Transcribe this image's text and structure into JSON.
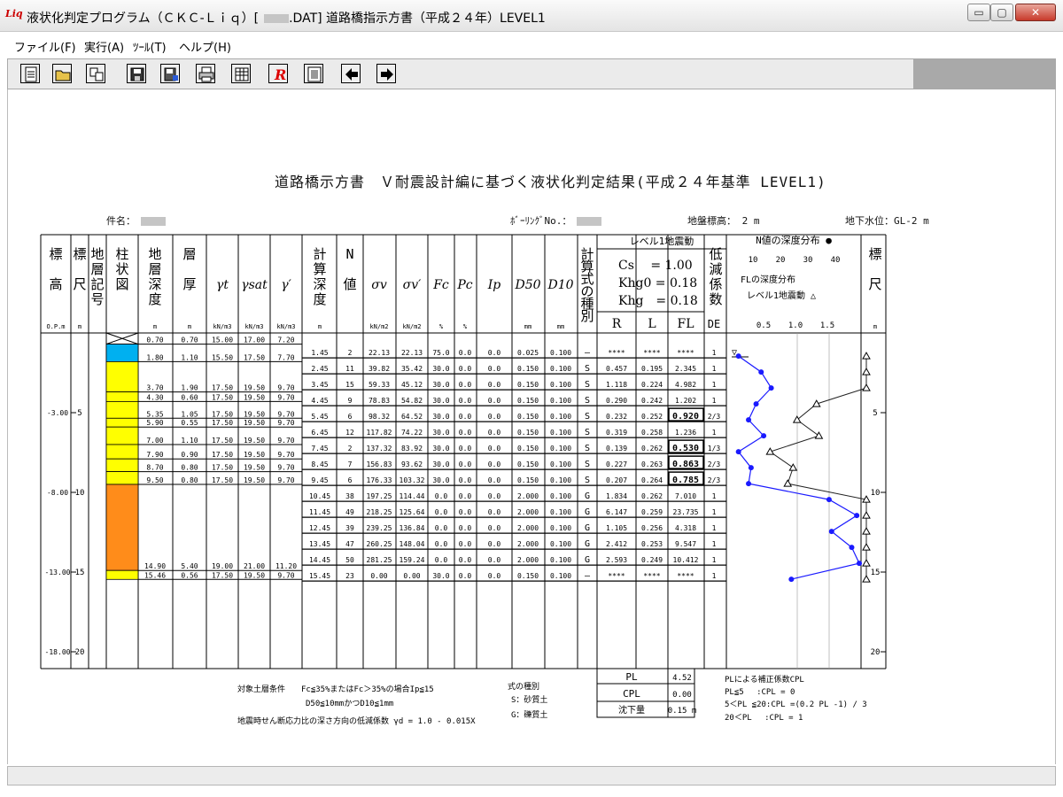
{
  "window": {
    "app_icon_text": "Liq",
    "title": "液状化判定プログラム（ＣＫＣ-Ｌｉｑ）[",
    "title_tail": ".DAT] 道路橋指示方書（平成２４年）LEVEL1",
    "min": "▭",
    "max": "▢",
    "close": "✕"
  },
  "menu": [
    "ファイル(F)",
    "実行(A)",
    "ﾂｰﾙ(T)",
    "ヘルプ(H)"
  ],
  "toolbar_icons": [
    "new-document-icon",
    "open-folder-icon",
    "copy-icon",
    "save-icon",
    "save-as-icon",
    "print-icon",
    "table-icon",
    "r-icon",
    "page-icon",
    "left-arrow-icon",
    "right-arrow-icon"
  ],
  "doc": {
    "title": "道路橋示方書　Ｖ耐震設計編に基づく液状化判定結果(平成２４年基準 LEVEL1)",
    "case_label": "件名：",
    "boring_label": "ﾎﾞｰﾘﾝｸﾞNo.：",
    "ground_elev": "地盤標高： 2 m",
    "water_level": "地下水位：GL-2 m"
  },
  "headers": {
    "elev": "標\n\n高",
    "scale": "標\n\n尺",
    "soil_code": "地\n層\n記\n号",
    "column": "柱\n状\n図",
    "depth": "地\n層\n深\n度",
    "thick": "層\n\n厚",
    "gt": "γt",
    "gsat": "γsat",
    "gp": "γ′",
    "calc_depth": "計\n算\n深\n度",
    "n": "N\n\n値",
    "sv": "σv",
    "svp": "σv′",
    "fc": "Fc",
    "pc": "Pc",
    "ip": "Ip",
    "d50": "D50",
    "d10": "D10",
    "formula": "計\n算\n式\nの\n種\n別",
    "level_group": "レベル1地震動",
    "cs": "Cs　 = 1.00",
    "khg0": "Khg0 = 0.18",
    "khg": "Khg　= 0.18",
    "reduce": "低\n減\n係\n数",
    "r": "R",
    "l": "L",
    "fl": "FL",
    "de": "DE",
    "nplot_title": "N値の深度分布 ●",
    "nplot_ticks": [
      "10",
      "20",
      "30",
      "40"
    ],
    "flplot_title": "FLの深度分布",
    "flplot_sub": "レベル1地震動 △",
    "flplot_ticks": [
      "0.5",
      "1.0",
      "1.5"
    ],
    "scale2": "標\n\n尺"
  },
  "units": {
    "elev": "O.P.m",
    "scale": "m",
    "depth": "m",
    "thick": "m",
    "gt": "kN/m3",
    "gsat": "kN/m3",
    "gp": "kN/m3",
    "calc_depth": "m",
    "sv": "kN/m2",
    "svp": "kN/m2",
    "fc": "%",
    "pc": "%",
    "d50": "mm",
    "d10": "mm",
    "scale2": "m"
  },
  "elev_labels": [
    "-3.00",
    "-8.00",
    "-13.00",
    "-18.00"
  ],
  "scale_labels": [
    "5",
    "10",
    "15",
    "20"
  ],
  "layers": [
    [
      "0.70",
      "0.70",
      "15.00",
      "17.00",
      "7.20"
    ],
    [
      "1.80",
      "1.10",
      "15.50",
      "17.50",
      "7.70"
    ],
    [
      "3.70",
      "1.90",
      "17.50",
      "19.50",
      "9.70"
    ],
    [
      "4.30",
      "0.60",
      "17.50",
      "19.50",
      "9.70"
    ],
    [
      "5.35",
      "1.05",
      "17.50",
      "19.50",
      "9.70"
    ],
    [
      "5.90",
      "0.55",
      "17.50",
      "19.50",
      "9.70"
    ],
    [
      "7.00",
      "1.10",
      "17.50",
      "19.50",
      "9.70"
    ],
    [
      "7.90",
      "0.90",
      "17.50",
      "19.50",
      "9.70"
    ],
    [
      "8.70",
      "0.80",
      "17.50",
      "19.50",
      "9.70"
    ],
    [
      "9.50",
      "0.80",
      "17.50",
      "19.50",
      "9.70"
    ],
    [
      "14.90",
      "5.40",
      "19.00",
      "21.00",
      "11.20"
    ],
    [
      "15.46",
      "0.56",
      "17.50",
      "19.50",
      "9.70"
    ]
  ],
  "rows": [
    [
      "1.45",
      "2",
      "22.13",
      "22.13",
      "75.0",
      "0.0",
      "0.0",
      "0.025",
      "0.100",
      "—",
      "****",
      "****",
      "****",
      "1"
    ],
    [
      "2.45",
      "11",
      "39.82",
      "35.42",
      "30.0",
      "0.0",
      "0.0",
      "0.150",
      "0.100",
      "S",
      "0.457",
      "0.195",
      "2.345",
      "1"
    ],
    [
      "3.45",
      "15",
      "59.33",
      "45.12",
      "30.0",
      "0.0",
      "0.0",
      "0.150",
      "0.100",
      "S",
      "1.118",
      "0.224",
      "4.982",
      "1"
    ],
    [
      "4.45",
      "9",
      "78.83",
      "54.82",
      "30.0",
      "0.0",
      "0.0",
      "0.150",
      "0.100",
      "S",
      "0.290",
      "0.242",
      "1.202",
      "1"
    ],
    [
      "5.45",
      "6",
      "98.32",
      "64.52",
      "30.0",
      "0.0",
      "0.0",
      "0.150",
      "0.100",
      "S",
      "0.232",
      "0.252",
      "0.920",
      "2/3"
    ],
    [
      "6.45",
      "12",
      "117.82",
      "74.22",
      "30.0",
      "0.0",
      "0.0",
      "0.150",
      "0.100",
      "S",
      "0.319",
      "0.258",
      "1.236",
      "1"
    ],
    [
      "7.45",
      "2",
      "137.32",
      "83.92",
      "30.0",
      "0.0",
      "0.0",
      "0.150",
      "0.100",
      "S",
      "0.139",
      "0.262",
      "0.530",
      "1/3"
    ],
    [
      "8.45",
      "7",
      "156.83",
      "93.62",
      "30.0",
      "0.0",
      "0.0",
      "0.150",
      "0.100",
      "S",
      "0.227",
      "0.263",
      "0.863",
      "2/3"
    ],
    [
      "9.45",
      "6",
      "176.33",
      "103.32",
      "30.0",
      "0.0",
      "0.0",
      "0.150",
      "0.100",
      "S",
      "0.207",
      "0.264",
      "0.785",
      "2/3"
    ],
    [
      "10.45",
      "38",
      "197.25",
      "114.44",
      "0.0",
      "0.0",
      "0.0",
      "2.000",
      "0.100",
      "G",
      "1.834",
      "0.262",
      "7.010",
      "1"
    ],
    [
      "11.45",
      "49",
      "218.25",
      "125.64",
      "0.0",
      "0.0",
      "0.0",
      "2.000",
      "0.100",
      "G",
      "6.147",
      "0.259",
      "23.735",
      "1"
    ],
    [
      "12.45",
      "39",
      "239.25",
      "136.84",
      "0.0",
      "0.0",
      "0.0",
      "2.000",
      "0.100",
      "G",
      "1.105",
      "0.256",
      "4.318",
      "1"
    ],
    [
      "13.45",
      "47",
      "260.25",
      "148.04",
      "0.0",
      "0.0",
      "0.0",
      "2.000",
      "0.100",
      "G",
      "2.412",
      "0.253",
      "9.547",
      "1"
    ],
    [
      "14.45",
      "50",
      "281.25",
      "159.24",
      "0.0",
      "0.0",
      "0.0",
      "2.000",
      "0.100",
      "G",
      "2.593",
      "0.249",
      "10.412",
      "1"
    ],
    [
      "15.45",
      "23",
      "0.00",
      "0.00",
      "30.0",
      "0.0",
      "0.0",
      "0.150",
      "0.100",
      "—",
      "****",
      "****",
      "****",
      "1"
    ]
  ],
  "chart_data": [
    {
      "type": "line",
      "title": "N値の深度分布",
      "x_ticks": [
        "10",
        "20",
        "30",
        "40"
      ],
      "xlim": [
        0,
        50
      ],
      "depth_labels": [
        "5",
        "10",
        "15",
        "20"
      ],
      "ylim": [
        0,
        20
      ],
      "series": [
        {
          "name": "N値",
          "points": [
            [
              2,
              1.45
            ],
            [
              11,
              2.45
            ],
            [
              15,
              3.45
            ],
            [
              9,
              4.45
            ],
            [
              6,
              5.45
            ],
            [
              12,
              6.45
            ],
            [
              2,
              7.45
            ],
            [
              7,
              8.45
            ],
            [
              6,
              9.45
            ],
            [
              38,
              10.45
            ],
            [
              49,
              11.45
            ],
            [
              39,
              12.45
            ],
            [
              47,
              13.45
            ],
            [
              50,
              14.45
            ],
            [
              23,
              15.45
            ]
          ]
        }
      ]
    },
    {
      "type": "line",
      "title": "FLの深度分布",
      "subtitle": "レベル1地震動",
      "x_ticks": [
        "0.5",
        "1.0",
        "1.5"
      ],
      "xlim": [
        0,
        2.0
      ],
      "ylim": [
        0,
        20
      ],
      "series": [
        {
          "name": "FL",
          "points": [
            [
              2.0,
              1.45
            ],
            [
              2.0,
              2.45
            ],
            [
              2.0,
              3.45
            ],
            [
              1.202,
              4.45
            ],
            [
              0.92,
              5.45
            ],
            [
              1.236,
              6.45
            ],
            [
              0.53,
              7.45
            ],
            [
              0.863,
              8.45
            ],
            [
              0.785,
              9.45
            ],
            [
              2.0,
              10.45
            ],
            [
              2.0,
              11.45
            ],
            [
              2.0,
              12.45
            ],
            [
              2.0,
              13.45
            ],
            [
              2.0,
              14.45
            ],
            [
              2.0,
              15.45
            ]
          ]
        }
      ]
    }
  ],
  "footer": {
    "cond1": "対象土層条件　　Fc≦35%またはFc＞35%の場合Ip≦15",
    "cond2": "D50≦10mmかつD10≦1mm",
    "cond3": "地震時せん断応力比の深さ方向の低減係数 γd = 1.0 - 0.015X",
    "kind_title": "式の種別",
    "kind_s": "S：砂質土",
    "kind_g": "G：礫質土",
    "pl_label": "PL",
    "pl_val": "4.52",
    "cpl_label": "CPL",
    "cpl_val": "0.00",
    "settle_label": "沈下量",
    "settle_val": "0.15 m",
    "note1": "PLによる補正係数CPL",
    "note2": "PL≦5　 :CPL = 0",
    "note3": "5＜PL ≦20:CPL =(0.2 PL -1) / 3",
    "note4": "20＜PL　 :CPL = 1"
  },
  "colors": {
    "sand": "#ffff00",
    "gravel": "#ff8c1a",
    "water": "#00b0f0",
    "n_series": "#1a1aff",
    "fl_series": "#222222"
  }
}
